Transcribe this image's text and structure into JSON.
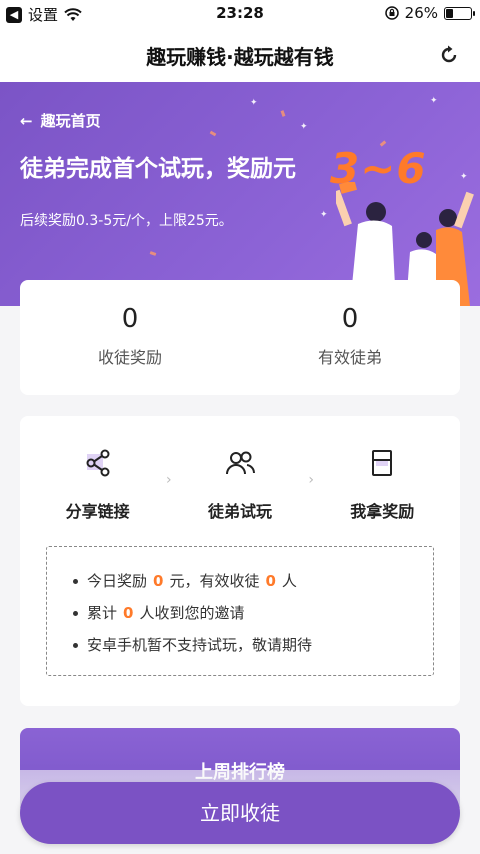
{
  "status_bar": {
    "back_app": "设置",
    "time": "23:28",
    "battery": "26%",
    "battery_level": 0.26
  },
  "nav": {
    "title": "趣玩赚钱·越玩越有钱",
    "refresh_icon": "refresh-icon"
  },
  "banner": {
    "back_label": "趣玩首页",
    "title": "徒弟完成首个试玩，奖励元",
    "highlight": "3~6",
    "subtitle": "后续奖励0.3-5元/个，上限25元。"
  },
  "stats": [
    {
      "value": "0",
      "label": "收徒奖励"
    },
    {
      "value": "0",
      "label": "有效徒弟"
    }
  ],
  "steps": [
    {
      "label": "分享链接",
      "icon": "share-icon"
    },
    {
      "label": "徒弟试玩",
      "icon": "users-icon"
    },
    {
      "label": "我拿奖励",
      "icon": "reward-box-icon"
    }
  ],
  "tips": {
    "line1_a": "今日奖励",
    "line1_v1": "0",
    "line1_b": "元，有效收徒",
    "line1_v2": "0",
    "line1_c": "人",
    "line2_a": "累计",
    "line2_v": "0",
    "line2_b": "人收到您的邀请",
    "line3": "安卓手机暂不支持试玩，敬请期待"
  },
  "ranking": {
    "title": "上周排行榜"
  },
  "cta": {
    "label": "立即收徒"
  },
  "colors": {
    "accent": "#7b52c4",
    "highlight": "#ff7a2a"
  }
}
